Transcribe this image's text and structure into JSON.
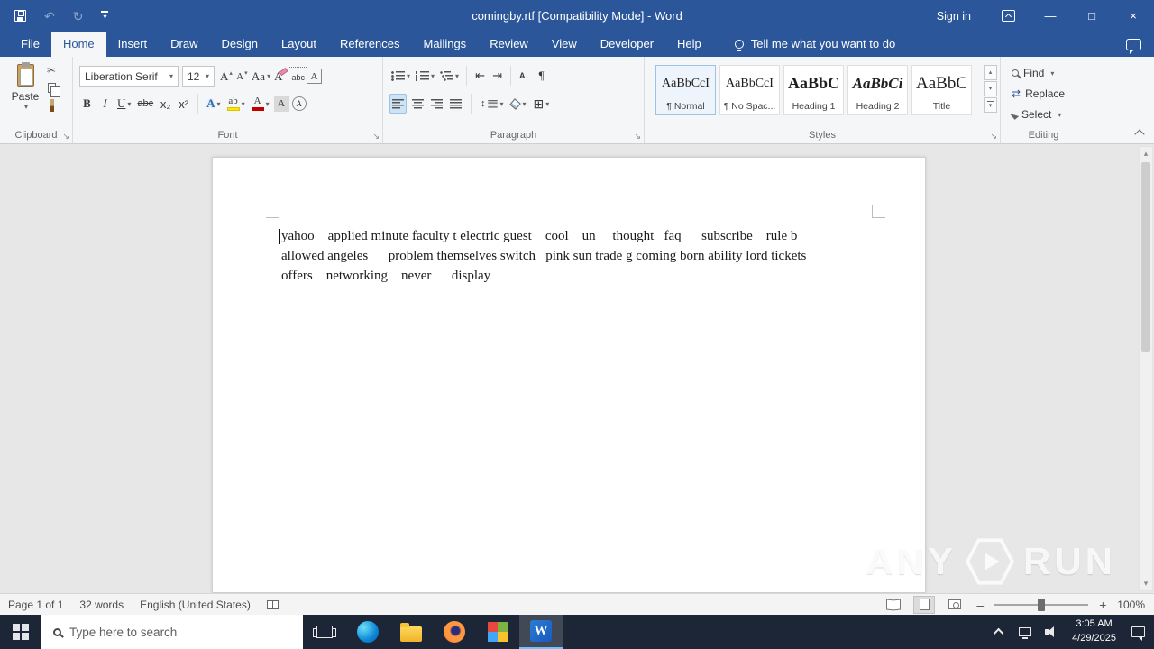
{
  "titlebar": {
    "title": "comingby.rtf [Compatibility Mode]  -  Word",
    "sign_in": "Sign in"
  },
  "tabs": [
    "File",
    "Home",
    "Insert",
    "Draw",
    "Design",
    "Layout",
    "References",
    "Mailings",
    "Review",
    "View",
    "Developer",
    "Help"
  ],
  "tellme": "Tell me what you want to do",
  "ribbon": {
    "clipboard": {
      "label": "Clipboard",
      "paste": "Paste"
    },
    "font": {
      "label": "Font",
      "name": "Liberation Serif",
      "size": "12",
      "grow": "A",
      "shrink": "A",
      "change_case": "Aa",
      "clear": "A",
      "phonetic": "abc",
      "char_border": "A",
      "bold": "B",
      "italic": "I",
      "underline": "U",
      "strike": "abc",
      "sub": "x₂",
      "sup": "x²",
      "effects": "A",
      "highlight": "ab",
      "color": "A",
      "shading": "A",
      "enclose": "A"
    },
    "paragraph": {
      "label": "Paragraph",
      "sort": "A↓",
      "pilcrow": "¶"
    },
    "styles": {
      "label": "Styles",
      "items": [
        {
          "preview": "AaBbCcI",
          "name": "¶ Normal"
        },
        {
          "preview": "AaBbCcI",
          "name": "¶ No Spac..."
        },
        {
          "preview": "AaBbC",
          "name": "Heading 1"
        },
        {
          "preview": "AaBbCi",
          "name": "Heading 2"
        },
        {
          "preview": "AaBbC",
          "name": "Title"
        }
      ]
    },
    "editing": {
      "label": "Editing",
      "find": "Find",
      "replace": "Replace",
      "select": "Select"
    }
  },
  "glyphs": {
    "dropdown": "▾",
    "up_arrow": "▴",
    "scissors": "✂",
    "undo": "↶",
    "redo": "↻",
    "launcher": "↘",
    "dec_indent": "⇤",
    "inc_indent": "⇥",
    "line_spacing": "↕",
    "replace_arrows": "⇄",
    "borders_grid": "⊞",
    "minimize": "—",
    "maximize": "□",
    "close": "×",
    "scroll_up": "▴",
    "scroll_down": "▾",
    "zoom_out": "–",
    "zoom_in": "+",
    "word_logo": "W"
  },
  "document": {
    "lines": [
      "yahoo    applied minute faculty t electric guest    cool    un     thought   faq      subscribe    rule b",
      "allowed angeles      problem themselves switch   pink sun trade g coming born ability lord tickets",
      "offers    networking    never      display"
    ]
  },
  "statusbar": {
    "page": "Page 1 of 1",
    "words": "32 words",
    "language": "English (United States)",
    "zoom": "100%"
  },
  "taskbar": {
    "search_placeholder": "Type here to search",
    "time": "3:05 AM",
    "date": "4/29/2025"
  },
  "watermark": {
    "any": "ANY",
    "run": "RUN"
  }
}
